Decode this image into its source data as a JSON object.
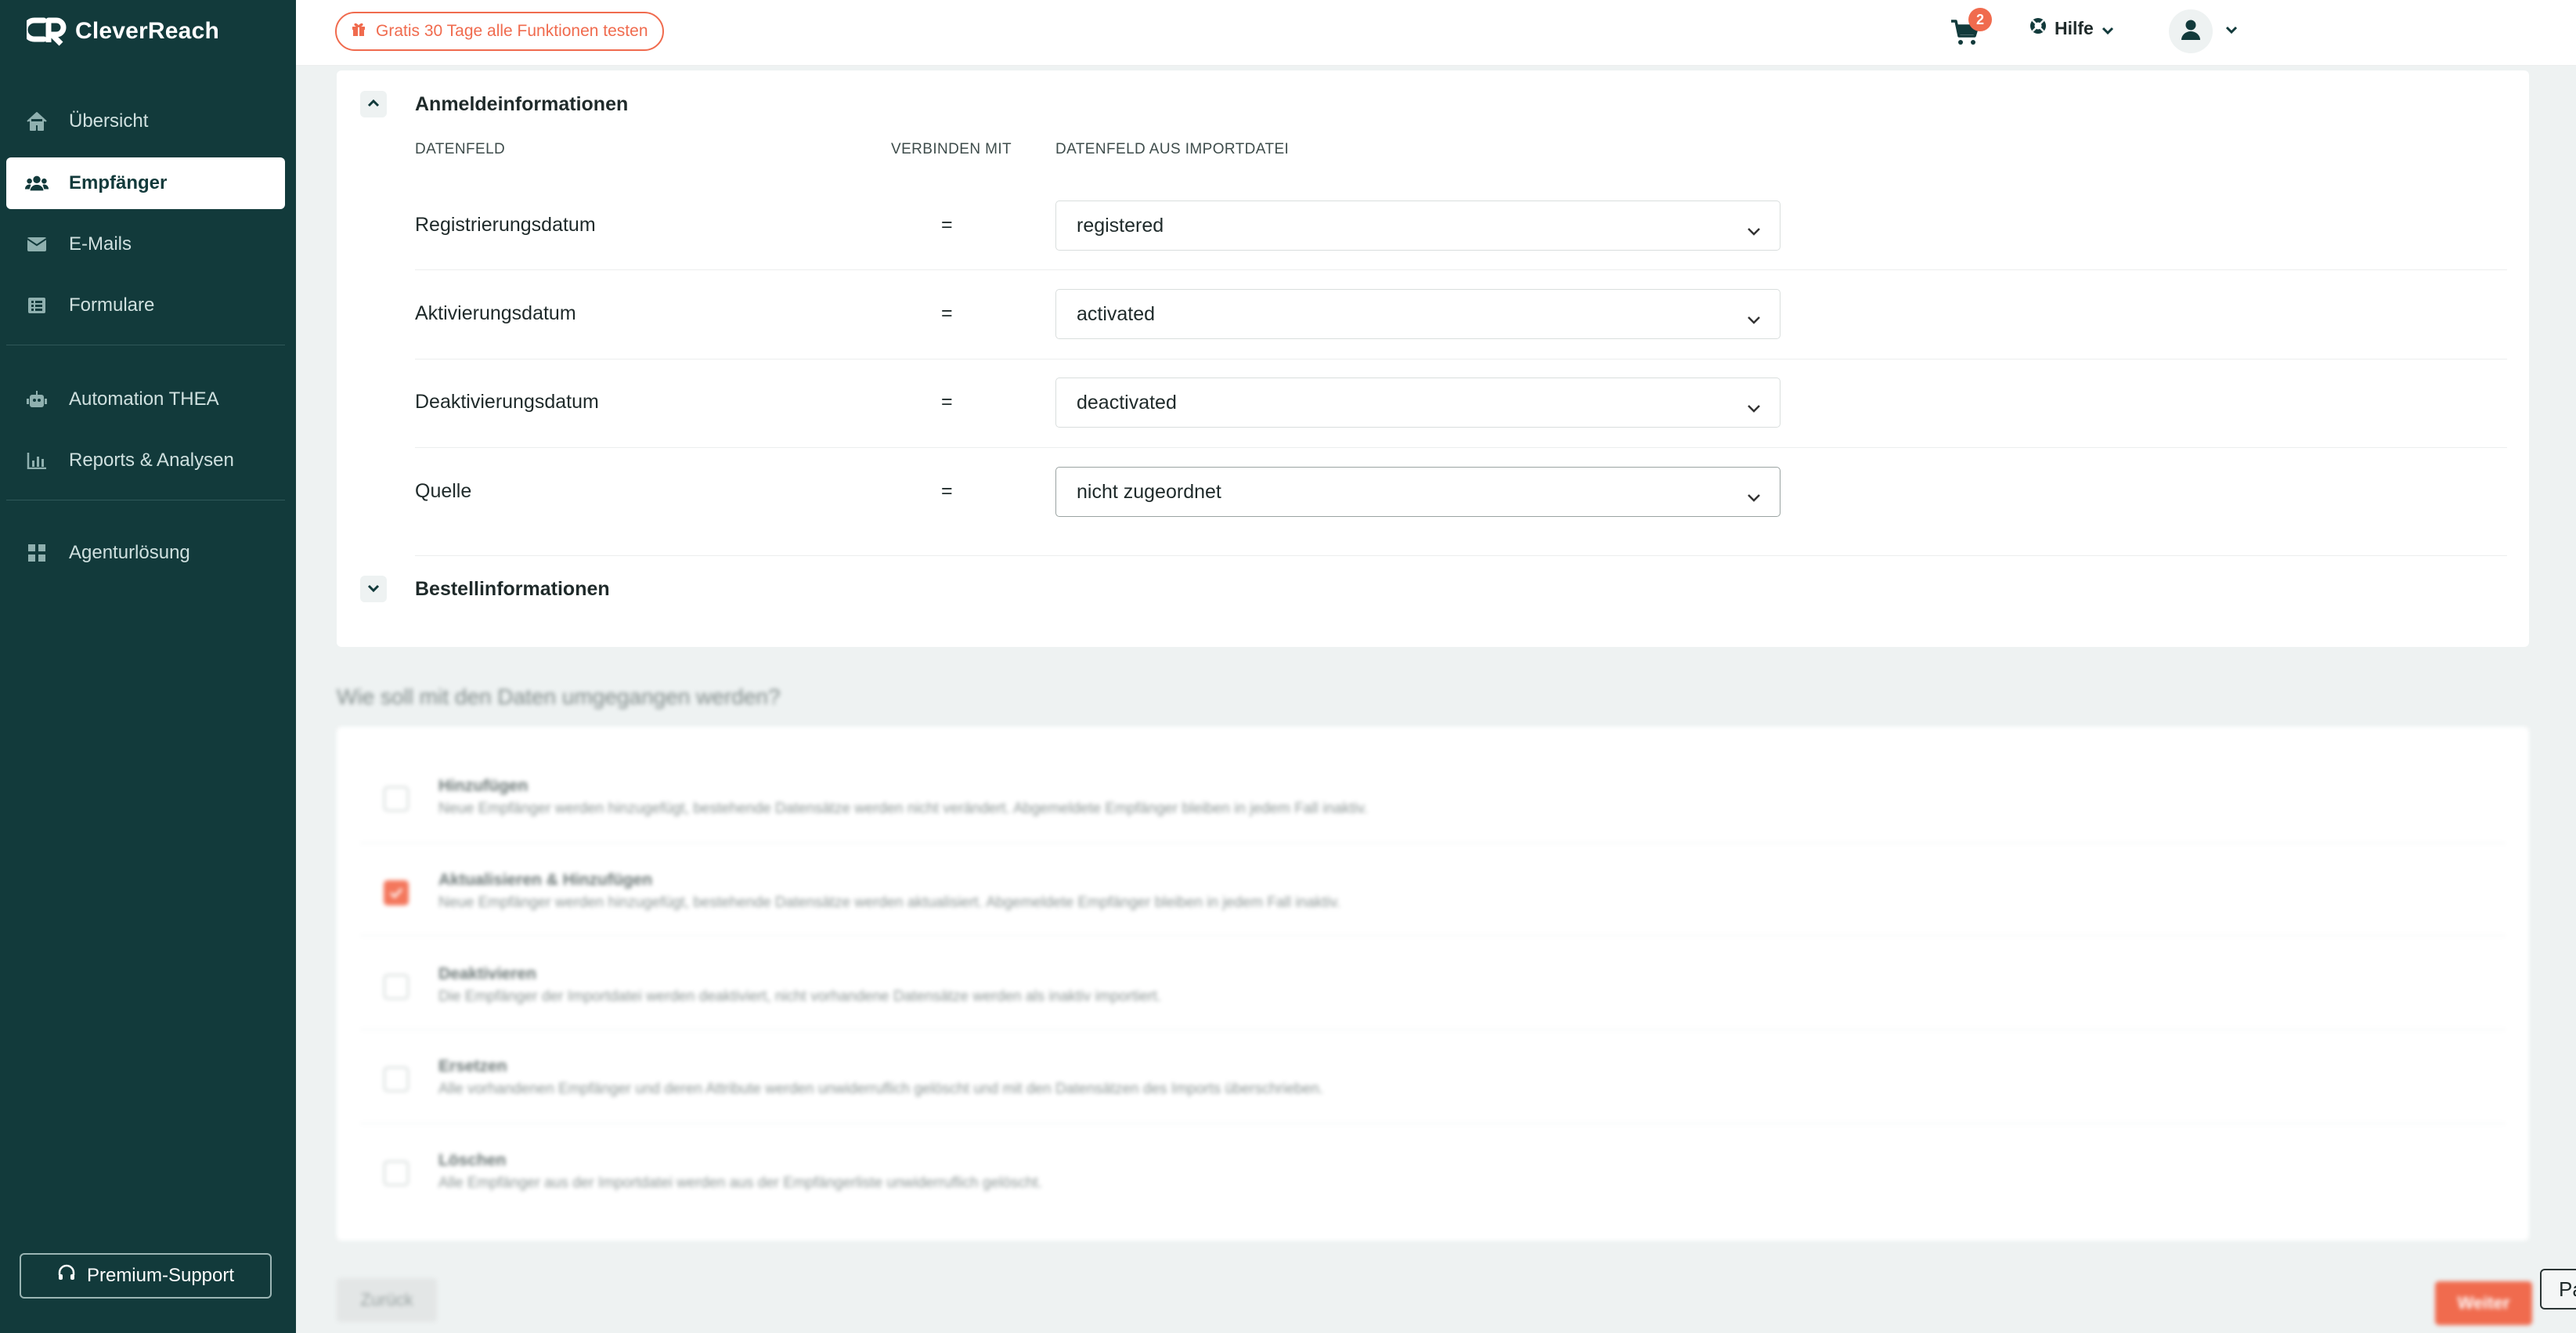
{
  "app": {
    "logo_text": "CleverReach"
  },
  "sidebar": {
    "items": [
      {
        "label": "Übersicht",
        "icon": "home-icon"
      },
      {
        "label": "Empfänger",
        "icon": "users-icon",
        "active": true
      },
      {
        "label": "E-Mails",
        "icon": "mail-icon"
      },
      {
        "label": "Formulare",
        "icon": "form-icon"
      },
      {
        "label": "Automation THEA",
        "icon": "robot-icon"
      },
      {
        "label": "Reports & Analysen",
        "icon": "bar-chart-icon"
      },
      {
        "label": "Agenturlösung",
        "icon": "grid-icon"
      }
    ],
    "support_label": "Premium-Support"
  },
  "topbar": {
    "promo_label": "Gratis 30 Tage alle Funktionen testen",
    "cart_count": "2",
    "help_label": "Hilfe"
  },
  "mapping": {
    "section_title": "Anmeldeinformationen",
    "columns": {
      "field": "DATENFELD",
      "connect": "VERBINDEN MIT",
      "import": "DATENFELD AUS IMPORTDATEI"
    },
    "rows": [
      {
        "label": "Registrierungsdatum",
        "operator": "=",
        "value": "registered"
      },
      {
        "label": "Aktivierungsdatum",
        "operator": "=",
        "value": "activated"
      },
      {
        "label": "Deaktivierungsdatum",
        "operator": "=",
        "value": "deactivated"
      },
      {
        "label": "Quelle",
        "operator": "=",
        "value": "nicht zugeordnet"
      }
    ],
    "collapsed_section_title": "Bestellinformationen"
  },
  "handling": {
    "question": "Wie soll mit den Daten umgegangen werden?",
    "options": [
      {
        "title": "Hinzufügen",
        "desc": "Neue Empfänger werden hinzugefügt, bestehende Datensätze werden nicht verändert. Abgemeldete Empfänger bleiben in jedem Fall inaktiv.",
        "checked": false
      },
      {
        "title": "Aktualisieren & Hinzufügen",
        "desc": "Neue Empfänger werden hinzugefügt, bestehende Datensätze werden aktualisiert. Abgemeldete Empfänger bleiben in jedem Fall inaktiv.",
        "checked": true
      },
      {
        "title": "Deaktivieren",
        "desc": "Die Empfänger der Importdatei werden deaktiviert, nicht vorhandene Datensätze werden als inaktiv importiert.",
        "checked": false
      },
      {
        "title": "Ersetzen",
        "desc": "Alle vorhandenen Empfänger und deren Attribute werden unwiderruflich gelöscht und mit den Datensätzen des Imports überschrieben.",
        "checked": false
      },
      {
        "title": "Löschen",
        "desc": "Alle Empfänger aus der Importdatei werden aus der Empfängerliste unwiderruflich gelöscht.",
        "checked": false
      }
    ]
  },
  "footer": {
    "back_label": "Zurück",
    "next_label": "Weiter",
    "partial_label": "Pa"
  }
}
